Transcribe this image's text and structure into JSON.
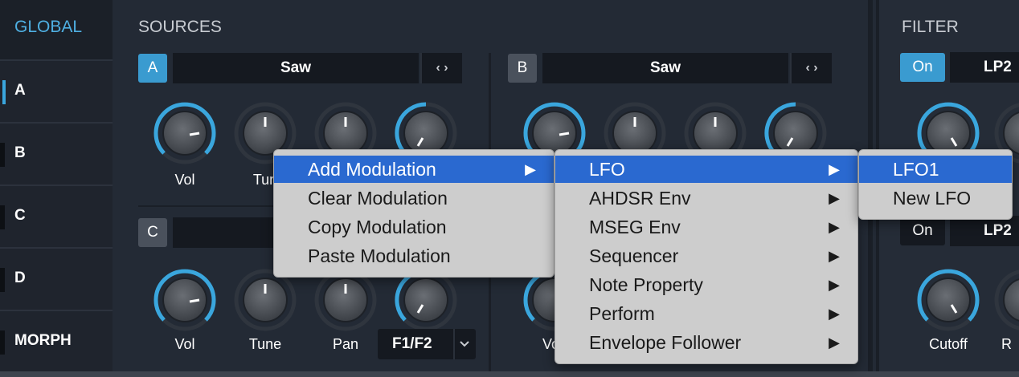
{
  "sidebar": {
    "global_label": "GLOBAL",
    "items": [
      {
        "label": "A"
      },
      {
        "label": "B"
      },
      {
        "label": "C"
      },
      {
        "label": "D"
      },
      {
        "label": "MORPH"
      }
    ]
  },
  "sources": {
    "title": "SOURCES",
    "source_a": {
      "badge": "A",
      "wave": "Saw"
    },
    "source_b": {
      "badge": "B",
      "wave": "Saw"
    },
    "source_c": {
      "badge": "C"
    },
    "knob_labels_row1": [
      "Vol",
      "Tun"
    ],
    "knob_labels_row2": [
      "Vol",
      "Tune",
      "Pan"
    ],
    "knob_labels_b_row2": [
      "Vo"
    ],
    "filter_route_value": "F1/F2",
    "arrow_left": "‹",
    "arrow_right": "›"
  },
  "filter": {
    "title": "FILTER",
    "row1": {
      "on_label": "On",
      "type": "LP2"
    },
    "row2": {
      "on_label": "On",
      "type": "LP2"
    },
    "knob_label": "Cutoff",
    "knob_label_partial": "R"
  },
  "context_menu": {
    "items": [
      "Add Modulation",
      "Clear Modulation",
      "Copy Modulation",
      "Paste Modulation"
    ],
    "highlighted_index": 0
  },
  "submenu": {
    "items": [
      "LFO",
      "AHDSR Env",
      "MSEG Env",
      "Sequencer",
      "Note Property",
      "Perform",
      "Envelope Follower"
    ],
    "highlighted_index": 0
  },
  "submenu2": {
    "items": [
      "LFO1",
      "New LFO"
    ],
    "highlighted_index": 0
  },
  "colors": {
    "accent": "#3a9bd0",
    "menu_highlight": "#2a69d0",
    "menu_bg": "#cdcdcd",
    "panel_bg": "#232a35"
  },
  "icons": {
    "submenu_arrow": "▶",
    "dropdown": "chevron-down-icon"
  }
}
